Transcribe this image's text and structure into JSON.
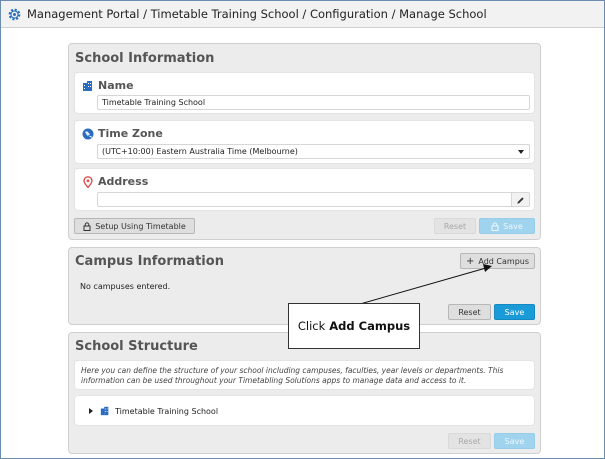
{
  "breadcrumb": {
    "text": "Management Portal / Timetable Training School / Configuration / Manage School"
  },
  "school_information": {
    "title": "School Information",
    "name": {
      "label": "Name",
      "value": "Timetable Training School"
    },
    "time_zone": {
      "label": "Time Zone",
      "value": "(UTC+10:00) Eastern Australia Time (Melbourne)"
    },
    "address": {
      "label": "Address",
      "value": ""
    },
    "setup_button": "Setup Using Timetable",
    "reset_button": "Reset",
    "save_button": "Save"
  },
  "campus_information": {
    "title": "Campus Information",
    "add_campus_button": "Add Campus",
    "empty_text": "No campuses entered.",
    "reset_button": "Reset",
    "save_button": "Save"
  },
  "callout": {
    "prefix": "Click",
    "bold": "Add Campus"
  },
  "school_structure": {
    "title": "School Structure",
    "description_line1": "Here you can define the structure of your school including campuses, faculties, year levels or departments. This",
    "description_line2": "information can be used throughout your Timetabling Solutions apps to manage data and access to it.",
    "tree_item": "Timetable Training School",
    "reset_button": "Reset",
    "save_button": "Save"
  },
  "colors": {
    "accent_blue": "#1a9bd7",
    "disabled_blue": "#9fd3ee",
    "location_red": "#d9534f"
  }
}
